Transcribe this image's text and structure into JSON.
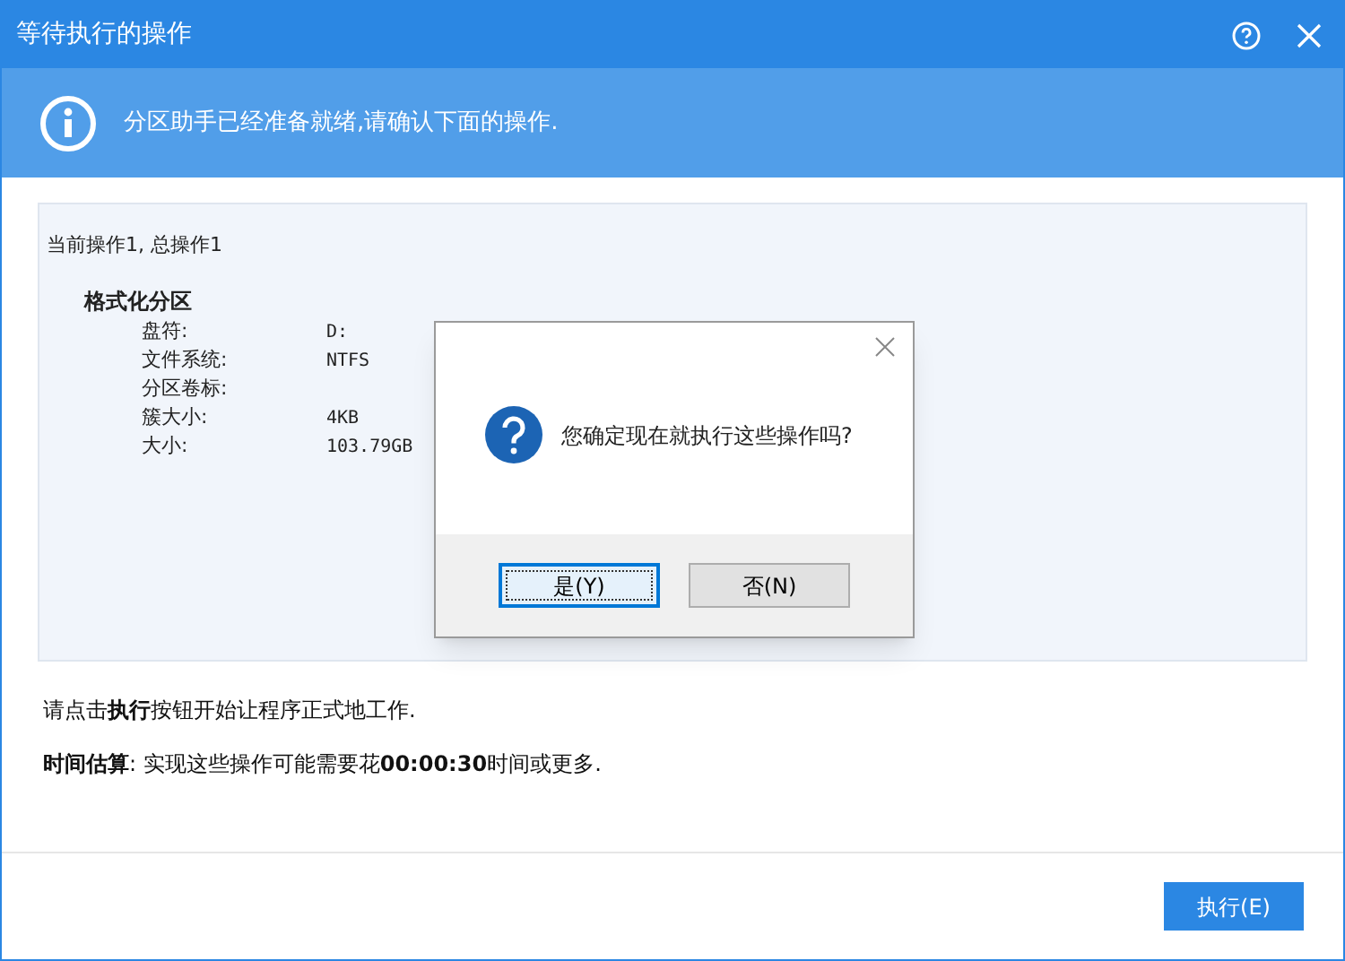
{
  "window": {
    "title": "等待执行的操作"
  },
  "banner": {
    "text": "分区助手已经准备就绪,请确认下面的操作."
  },
  "operations": {
    "summary": "当前操作1, 总操作1",
    "title": "格式化分区",
    "fields": [
      {
        "label": "盘符:",
        "value": "D:"
      },
      {
        "label": "文件系统:",
        "value": "NTFS"
      },
      {
        "label": "分区卷标:"
      },
      {
        "label": "簇大小:",
        "value": "4KB"
      },
      {
        "label": "大小:",
        "value": "103.79GB"
      }
    ]
  },
  "instructions": [
    "请点击**执行**按钮开始让程序正式地工作.",
    "**时间估算**: 实现这些操作可能需要花**00:00:30**时间或更多."
  ],
  "execute_button": "执行(E)",
  "confirm_dialog": {
    "message": "您确定现在就执行这些操作吗?",
    "buttons": [
      {
        "label": "是(Y)",
        "selected": true
      },
      {
        "label": "否(N)",
        "selected": false
      }
    ]
  }
}
